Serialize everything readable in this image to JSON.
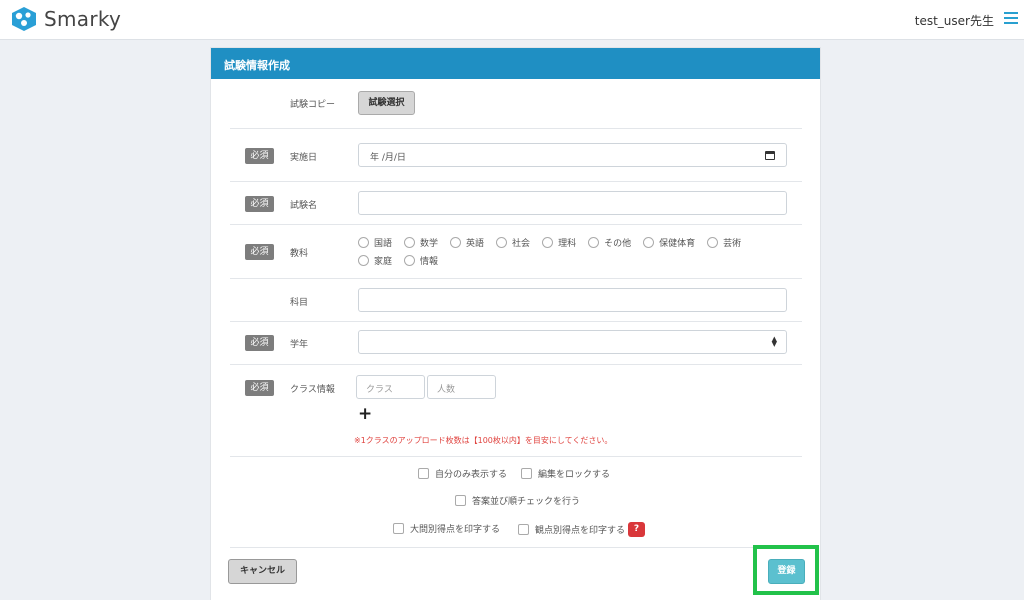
{
  "header": {
    "logo_text": "Smarky",
    "user_name": "test_user先生"
  },
  "panel": {
    "title": "試験情報作成",
    "copy": {
      "label": "試験コピー",
      "button": "試験選択"
    },
    "required_badge": "必須",
    "date": {
      "label": "実施日",
      "placeholder": "年 /月/日"
    },
    "exam_name": {
      "label": "試験名",
      "value": ""
    },
    "subject": {
      "label": "教科",
      "options": [
        "国語",
        "数学",
        "英語",
        "社会",
        "理科",
        "その他",
        "保健体育",
        "芸術",
        "家庭",
        "情報"
      ]
    },
    "course": {
      "label": "科目",
      "value": ""
    },
    "grade": {
      "label": "学年",
      "value": ""
    },
    "class_info": {
      "label": "クラス情報",
      "class_placeholder": "クラス",
      "count_placeholder": "人数",
      "add_symbol": "+",
      "note": "※1クラスのアップロード枚数は【100枚以内】を目安にしてください。"
    },
    "options": {
      "self_only": "自分のみ表示する",
      "lock_edit": "編集をロックする",
      "order_check": "答案並び順チェックを行う",
      "print_major": "大問別得点を印字する",
      "print_viewpoint": "観点別得点を印字する",
      "help": "?"
    },
    "buttons": {
      "cancel": "キャンセル",
      "save": "登録"
    }
  },
  "colors": {
    "accent": "#1f8fc3",
    "save": "#5bc0cf",
    "highlight": "#22c24a",
    "note": "#e0433f"
  }
}
